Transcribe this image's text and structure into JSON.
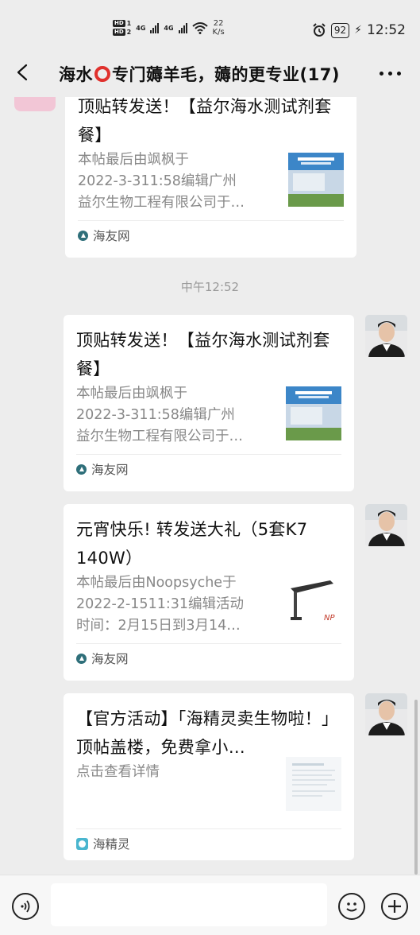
{
  "status_bar": {
    "hd1": "HD",
    "hd1_sub": "1",
    "hd2": "HD",
    "hd2_sub": "2",
    "net1": "4G",
    "net2": "4G",
    "speed_value": "22",
    "speed_unit": "K/s",
    "battery": "92",
    "time": "12:52",
    "icons": [
      "signal-icon",
      "wifi-icon",
      "alarm-icon",
      "battery-icon",
      "charging-icon"
    ]
  },
  "header": {
    "title_before": "海水",
    "title_after": "专门薅羊毛，薅的更专业(17)",
    "title_icon_color": "#e0312d",
    "back_icon": "back-arrow-icon",
    "more_icon": "more-icon"
  },
  "messages": [
    {
      "title": "顶贴转发送！【益尔海水测试剂套餐】",
      "desc_lines": [
        "本帖最后由飒枫于",
        "2022-3-311:58编辑广州",
        "益尔生物工程有限公司于…"
      ],
      "source": "海友网",
      "thumb": "building-photo"
    },
    {
      "time_label": "中午12:52"
    },
    {
      "title": "顶贴转发送！【益尔海水测试剂套餐】",
      "desc_lines": [
        "本帖最后由飒枫于",
        "2022-3-311:58编辑广州",
        "益尔生物工程有限公司于…"
      ],
      "source": "海友网",
      "thumb": "building-photo"
    },
    {
      "title": "元宵快乐! 转发送大礼（5套K7 140W）",
      "desc_lines": [
        "本帖最后由Noopsyche于",
        "2022-2-1511:31编辑活动",
        "时间：2月15日到3月14…"
      ],
      "source": "海友网",
      "thumb": "lamp-product-photo"
    },
    {
      "title": "【官方活动】「海精灵卖生物啦！」顶帖盖楼，免费拿小…",
      "desc_lines": [
        "点击查看详情"
      ],
      "source": "海精灵",
      "thumb": "document-thumbnail"
    }
  ],
  "input_bar": {
    "placeholder": "",
    "voice_icon": "voice-icon",
    "emoji_icon": "emoji-icon",
    "plus_icon": "plus-icon"
  },
  "colors": {
    "background": "#ededed",
    "card": "#ffffff",
    "accent_red": "#e0312d"
  }
}
